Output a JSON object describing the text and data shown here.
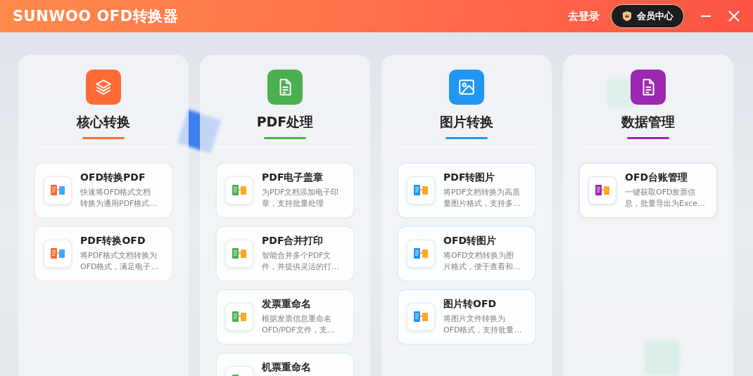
{
  "header": {
    "title": "SUNWOO OFD转换器",
    "login": "去登录",
    "member_button": "会员中心"
  },
  "columns": [
    {
      "title": "核心转换",
      "color": "#ff6b35",
      "cards": [
        {
          "title": "OFD转换PDF",
          "description_lines": [
            "快速将OFD格式文档",
            "转换为通用PDF格式…"
          ]
        },
        {
          "title": "PDF转换OFD",
          "description_lines": [
            "将PDF格式文档转换为",
            "OFD格式，满足电子…"
          ]
        }
      ]
    },
    {
      "title": "PDF处理",
      "color": "#4caf50",
      "cards": [
        {
          "title": "PDF电子盖章",
          "description_lines": [
            "为PDF文档添加电子印",
            "章，支持批量处理"
          ]
        },
        {
          "title": "PDF合并打印",
          "description_lines": [
            "智能合并多个PDF文",
            "件，并提供灵活的打…"
          ]
        },
        {
          "title": "发票重命名",
          "description_lines": [
            "根据发票信息重命名",
            "OFD/PDF文件，支…"
          ]
        },
        {
          "title": "机票重命名"
        }
      ]
    },
    {
      "title": "图片转换",
      "color": "#2196f3",
      "cards": [
        {
          "title": "PDF转图片",
          "description_lines": [
            "将PDF文档转换为高质",
            "量图片格式，支持多…"
          ]
        },
        {
          "title": "OFD转图片",
          "description_lines": [
            "将OFD文档转换为图",
            "片格式，便于查看和…"
          ]
        },
        {
          "title": "图片转OFD",
          "description_lines": [
            "将图片文件转换为",
            "OFD格式，支持批量…"
          ]
        }
      ]
    },
    {
      "title": "数据管理",
      "color": "#9c27b0",
      "cards": [
        {
          "title": "OFD台账管理",
          "description_lines": [
            "一键获取OFD发票信",
            "息，批量导出为Exce…"
          ]
        }
      ]
    }
  ]
}
